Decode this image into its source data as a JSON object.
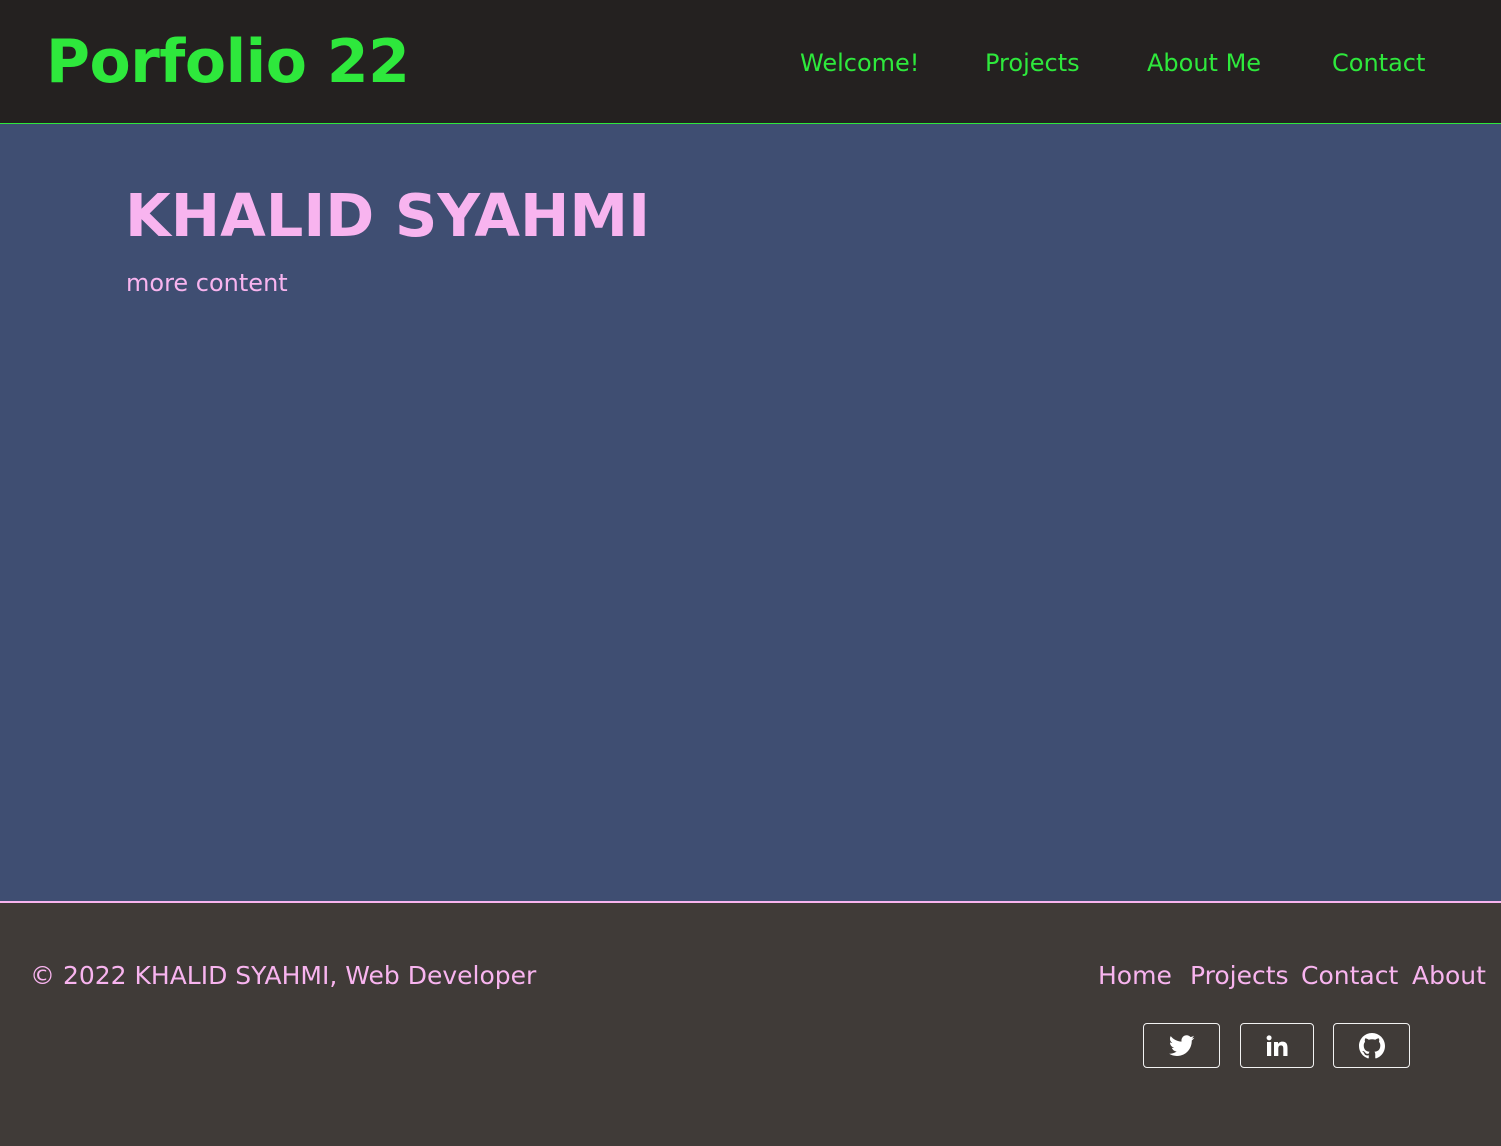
{
  "header": {
    "brand": "Porfolio 22",
    "nav": [
      {
        "label": "Welcome!"
      },
      {
        "label": "Projects"
      },
      {
        "label": "About Me"
      },
      {
        "label": "Contact"
      }
    ]
  },
  "main": {
    "title": "KHALID SYAHMI",
    "subtitle": "more content"
  },
  "footer": {
    "copyright": "© 2022 KHALID SYAHMI, Web Developer",
    "links": [
      {
        "label": "Home"
      },
      {
        "label": "Projects"
      },
      {
        "label": "Contact"
      },
      {
        "label": "About"
      }
    ],
    "social": [
      {
        "icon": "twitter-icon"
      },
      {
        "icon": "linkedin-icon"
      },
      {
        "icon": "github-icon"
      }
    ]
  },
  "colors": {
    "header_bg": "#242120",
    "accent_green": "#2ee83c",
    "main_bg": "#3f4e72",
    "accent_pink": "#f8b4ef",
    "footer_bg": "#403b38"
  }
}
